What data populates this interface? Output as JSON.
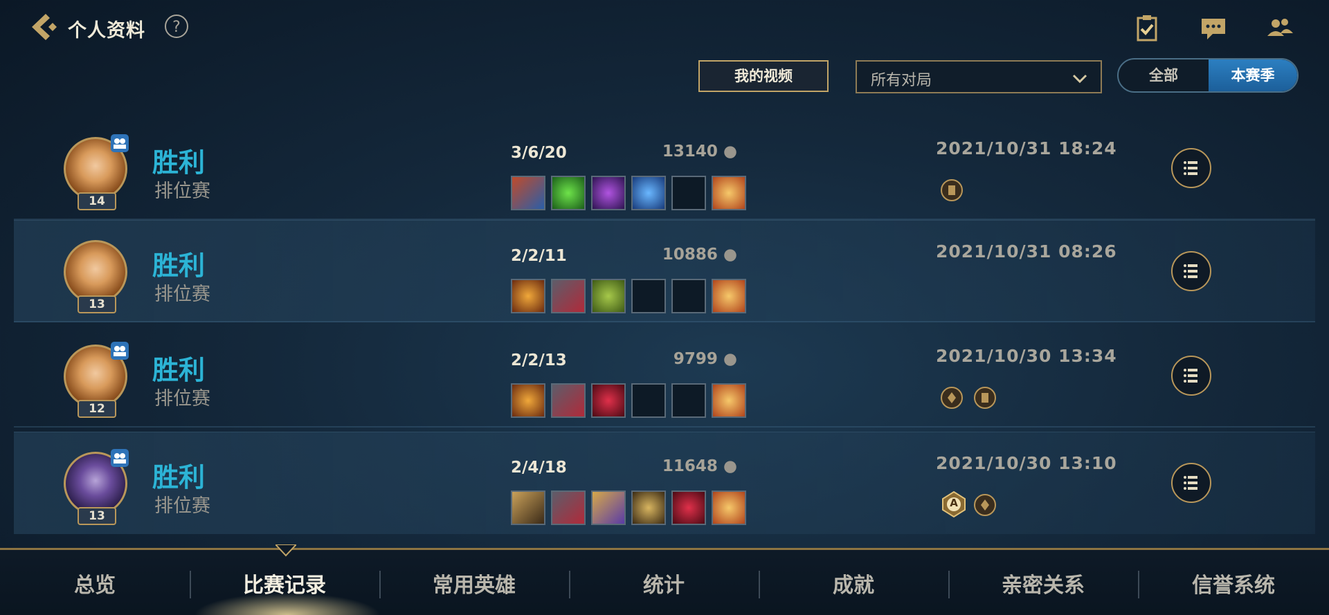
{
  "header": {
    "title": "个人资料",
    "help_label": "?"
  },
  "filters": {
    "video_button": "我的视频",
    "match_filter": "所有对局",
    "toggle": {
      "all": "全部",
      "season": "本赛季",
      "selected": "本赛季"
    }
  },
  "matches": [
    {
      "result": "胜利",
      "mode": "排位赛",
      "level": "14",
      "kda": "3/6/20",
      "gold": "13140",
      "time": "2021/10/31 18:24"
    },
    {
      "result": "胜利",
      "mode": "排位赛",
      "level": "13",
      "kda": "2/2/11",
      "gold": "10886",
      "time": "2021/10/31 08:26"
    },
    {
      "result": "胜利",
      "mode": "排位赛",
      "level": "12",
      "kda": "2/2/13",
      "gold": "9799",
      "time": "2021/10/30 13:34"
    },
    {
      "result": "胜利",
      "mode": "排位赛",
      "level": "13",
      "kda": "2/4/18",
      "gold": "11648",
      "time": "2021/10/30 13:10"
    }
  ],
  "tabs": [
    {
      "label": "总览"
    },
    {
      "label": "比赛记录"
    },
    {
      "label": "常用英雄"
    },
    {
      "label": "统计"
    },
    {
      "label": "成就"
    },
    {
      "label": "亲密关系"
    },
    {
      "label": "信誉系统"
    }
  ],
  "active_tab": "比赛记录",
  "colors": {
    "victory": "#2cb4d6",
    "accent_gold": "#b9975a",
    "season_blue": "#2c7fc1"
  },
  "badge_letter": "A"
}
